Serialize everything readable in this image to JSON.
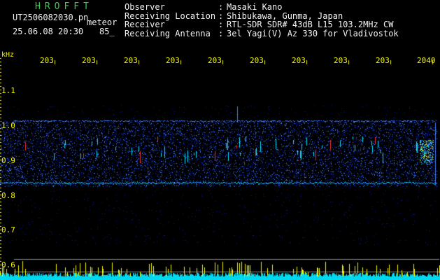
{
  "header": {
    "title": "HROFFT",
    "filename": "UT2506082030.pn",
    "meteor_label": "meteor",
    "datetime": "25.06.08 20:30",
    "count": "85_"
  },
  "info": [
    {
      "key": "Observer",
      "value": "Masaki Kano"
    },
    {
      "key": "Receiving Location",
      "value": "Shibukawa, Gunma, Japan"
    },
    {
      "key": "Receiver",
      "value": "RTL-SDR SDR# 43dB L15 103.2MHz CW"
    },
    {
      "key": "Receiving Antenna",
      "value": "3el Yagi(V) Az 330 for Vladivostok"
    }
  ],
  "axis": {
    "unit": "kHz",
    "x_ticks": [
      "203",
      "203",
      "203",
      "203",
      "203",
      "203",
      "203",
      "203",
      "203",
      "2040"
    ],
    "y_ticks": [
      "1.1",
      "1.0",
      "0.9",
      "0.8",
      "0.7",
      "0.6"
    ]
  },
  "colors": {
    "background": "#000000",
    "title": "#3ccb4b",
    "text": "#f2f2f2",
    "axis": "#f4f400",
    "noise_dark": "#0a1a8c",
    "noise_bright": "#3f7cff",
    "signal_cyan": "#00e5ff",
    "echo_red": "#ff2a2a",
    "histogram_cyan": "#00d8f0",
    "histogram_yellow": "#f4f400"
  }
}
